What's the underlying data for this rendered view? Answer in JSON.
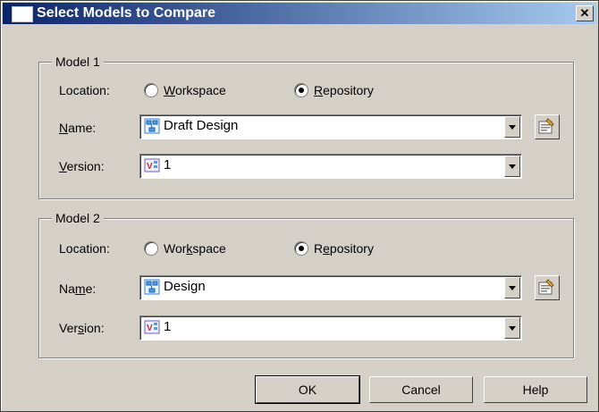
{
  "window": {
    "title": "Select Models to Compare",
    "close_glyph": "✕"
  },
  "model1": {
    "group_label": "Model 1",
    "location_label": "Location:",
    "workspace_option": {
      "label": "Workspace",
      "selected": false
    },
    "repository_option": {
      "label": "Repository",
      "selected": true
    },
    "name_label": "Name:",
    "name_value": "Draft Design",
    "name_icon": "physical-diagram-icon",
    "version_label": "Version:",
    "version_value": "1",
    "version_icon": "version-icon",
    "properties_icon": "properties-icon"
  },
  "model2": {
    "group_label": "Model 2",
    "location_label": "Location:",
    "workspace_option": {
      "label": "Workspace",
      "selected": false
    },
    "repository_option": {
      "label": "Repository",
      "selected": true
    },
    "name_label": "Name:",
    "name_value": "Design",
    "name_icon": "physical-diagram-icon",
    "version_label": "Version:",
    "version_value": "1",
    "version_icon": "version-icon",
    "properties_icon": "properties-icon"
  },
  "buttons": {
    "ok": "OK",
    "cancel": "Cancel",
    "help": "Help"
  },
  "colors": {
    "titlebar_start": "#0a246a",
    "titlebar_end": "#a6caf0",
    "dialog_face": "#d4d0c8"
  }
}
